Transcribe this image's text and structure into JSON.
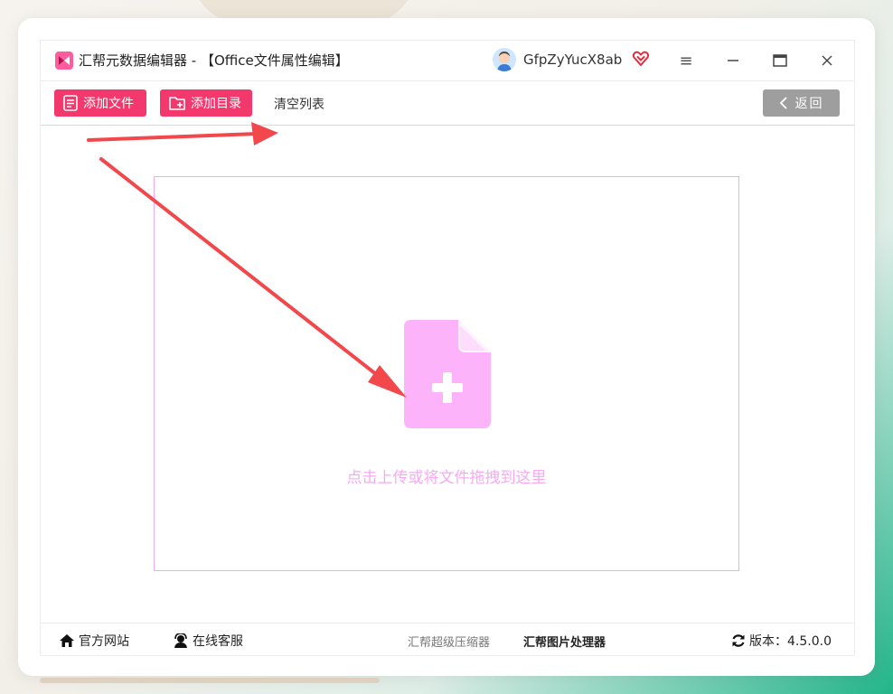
{
  "app": {
    "title": "汇帮元数据编辑器 - 【Office文件属性编辑】",
    "username": "GfpZyYucX8ab",
    "brand_color": "#f2386d",
    "logo_icon": "app-logo-icon"
  },
  "window_controls": {
    "menu_icon": "≡",
    "minimize_icon": "—",
    "maximize_icon": "▭",
    "close_icon": "×"
  },
  "toolbar": {
    "add_file_label": "添加文件",
    "add_folder_label": "添加目录",
    "clear_label": "清空列表",
    "back_label": "返回"
  },
  "dropzone": {
    "hint": "点击上传或将文件拖拽到这里",
    "accent_color": "#f7a9f3"
  },
  "statusbar": {
    "website_label": "官方网站",
    "support_label": "在线客服",
    "link_compressor": "汇帮超级压缩器",
    "link_image_tool": "汇帮图片处理器",
    "version_label": "版本：4.5.0.0"
  },
  "annotations": {
    "arrow_color": "#f2484b"
  }
}
